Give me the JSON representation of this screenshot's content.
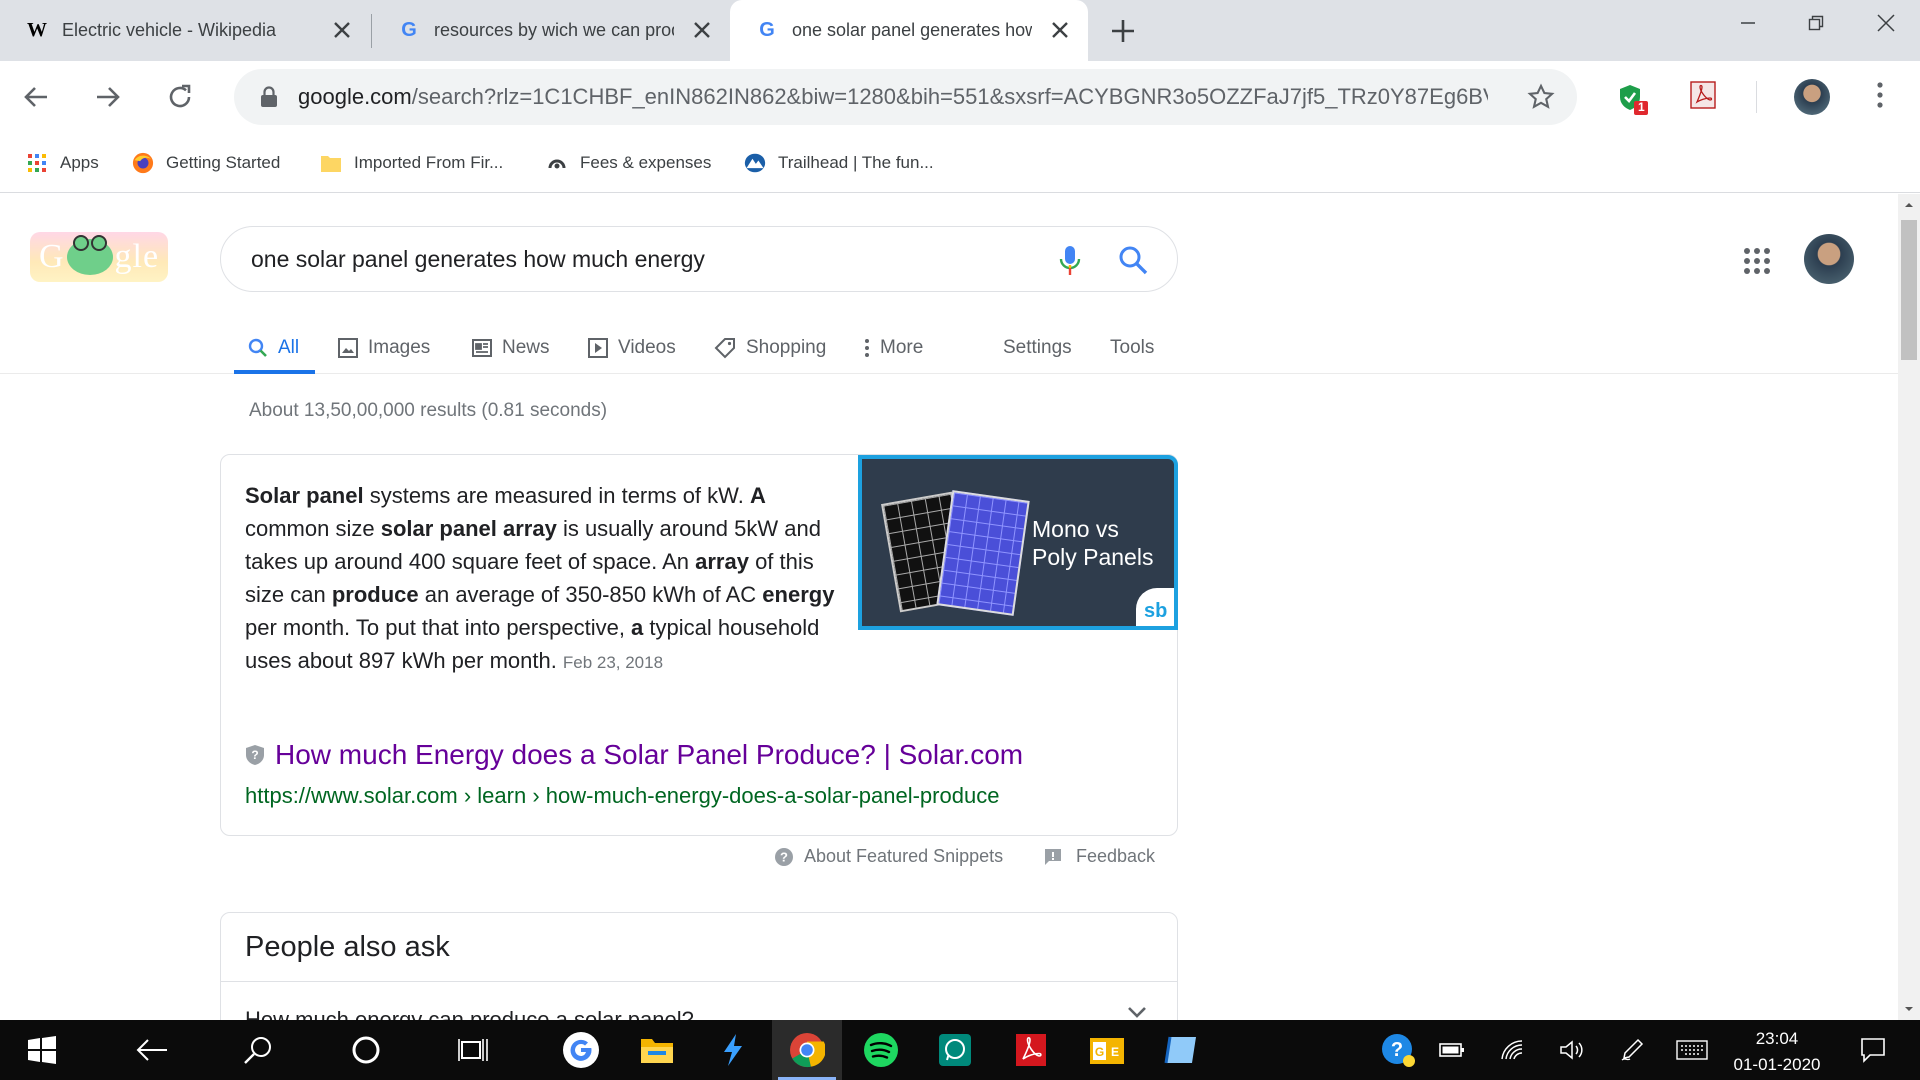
{
  "browser": {
    "tabs": [
      {
        "title": "Electric vehicle - Wikipedia",
        "favicon": "W"
      },
      {
        "title": "resources by wich we can prod",
        "favicon": "G"
      },
      {
        "title": "one solar panel generates how",
        "favicon": "G"
      }
    ],
    "url_host": "google.com",
    "url_path": "/search?rlz=1C1CHBF_enIN862IN862&biw=1280&bih=551&sxsrf=ACYBGNR3o5OZZFaJ7jf5_TRz0Y87Eg6BV...",
    "extension_badge": "1",
    "bookmarks": [
      "Apps",
      "Getting Started",
      "Imported From Fir...",
      "Fees & expenses",
      "Trailhead | The fun..."
    ]
  },
  "search": {
    "logo_text_left": "G",
    "logo_text_right": "gle",
    "query": "one solar panel generates how much energy",
    "tabs": [
      "All",
      "Images",
      "News",
      "Videos",
      "Shopping",
      "More",
      "Settings",
      "Tools"
    ],
    "stats": "About 13,50,00,000 results (0.81 seconds)"
  },
  "snippet": {
    "segments": [
      {
        "t": "Solar panel",
        "b": true
      },
      {
        "t": " systems are measured in terms of kW. ",
        "b": false
      },
      {
        "t": "A",
        "b": true
      },
      {
        "t": " common size ",
        "b": false
      },
      {
        "t": "solar panel array",
        "b": true
      },
      {
        "t": " is usually around 5kW and takes up around 400 square feet of space. An ",
        "b": false
      },
      {
        "t": "array",
        "b": true
      },
      {
        "t": " of this size can ",
        "b": false
      },
      {
        "t": "produce",
        "b": true
      },
      {
        "t": " an average of 350-850 kWh of AC ",
        "b": false
      },
      {
        "t": "energy",
        "b": true
      },
      {
        "t": " per month. To put that into perspective, ",
        "b": false
      },
      {
        "t": "a",
        "b": true
      },
      {
        "t": " typical household uses about 897 kWh per month.",
        "b": false
      }
    ],
    "date": "Feb 23, 2018",
    "image_caption_line1": "Mono vs",
    "image_caption_line2": "Poly Panels",
    "image_badge": "sb",
    "result_title": "How much Energy does a Solar Panel Produce? | Solar.com",
    "result_cite": "https://www.solar.com › learn › how-much-energy-does-a-solar-panel-produce",
    "about_label": "About Featured Snippets",
    "feedback_label": "Feedback"
  },
  "people_also_ask": {
    "heading": "People also ask",
    "questions": [
      "How much energy can produce a solar panel?"
    ]
  },
  "taskbar": {
    "time": "23:04",
    "date": "01-01-2020"
  },
  "colors": {
    "accent": "#1a73e8",
    "visited_link": "#660099",
    "cite_green": "#006621",
    "tabstrip": "#dee1e6"
  }
}
